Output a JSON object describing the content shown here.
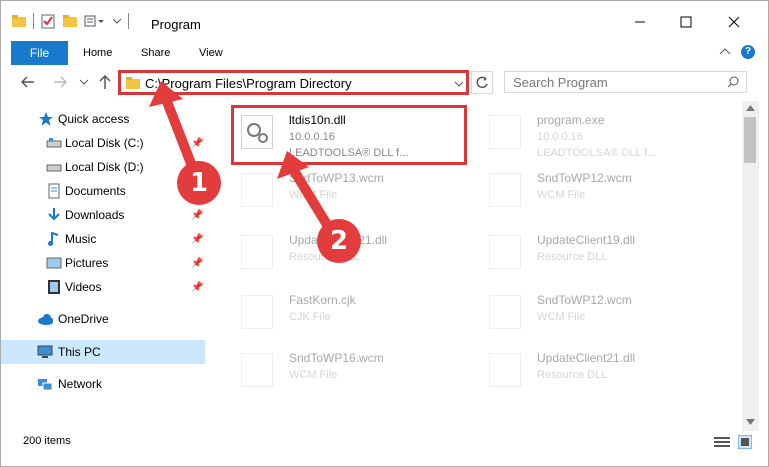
{
  "window": {
    "title": "Program"
  },
  "ribbon": {
    "tabs": [
      "File",
      "Home",
      "Share",
      "View"
    ],
    "help": "?"
  },
  "nav": {
    "address": "C:\\Program Files\\Program Directory",
    "search_placeholder": "Search Program"
  },
  "sidebar": {
    "items": [
      {
        "label": "Quick access",
        "pinned": false
      },
      {
        "label": "Local Disk (C:)",
        "pinned": true
      },
      {
        "label": "Local Disk (D:)",
        "pinned": true
      },
      {
        "label": "Documents",
        "pinned": true
      },
      {
        "label": "Downloads",
        "pinned": true
      },
      {
        "label": "Music",
        "pinned": true
      },
      {
        "label": "Pictures",
        "pinned": true
      },
      {
        "label": "Videos",
        "pinned": true
      },
      {
        "label": "OneDrive",
        "pinned": false
      },
      {
        "label": "This PC",
        "pinned": false
      },
      {
        "label": "Network",
        "pinned": false
      }
    ]
  },
  "files": [
    {
      "name": "ltdis10n.dll",
      "line2": "10.0.0.16",
      "line3": "LEADTOOLSA® DLL f..."
    },
    {
      "name": "program.exe",
      "line2": "10.0.0.16",
      "line3": "LEADTOOLSA® DLL f..."
    },
    {
      "name": "SndToWP13.wcm",
      "line2": "WCM File",
      "line3": ""
    },
    {
      "name": "SndToWP12.wcm",
      "line2": "WCM File",
      "line3": ""
    },
    {
      "name": "UpdateClient21.dll",
      "line2": "Resource DLL",
      "line3": ""
    },
    {
      "name": "UpdateClient19.dll",
      "line2": "Resource DLL",
      "line3": ""
    },
    {
      "name": "FastKorn.cjk",
      "line2": "CJK File",
      "line3": ""
    },
    {
      "name": "SndToWP12.wcm",
      "line2": "WCM File",
      "line3": ""
    },
    {
      "name": "SndToWP16.wcm",
      "line2": "WCM File",
      "line3": ""
    },
    {
      "name": "UpdateClient21.dll",
      "line2": "Resource DLL",
      "line3": ""
    }
  ],
  "status": {
    "count": "200 items"
  },
  "callouts": [
    "1",
    "2"
  ],
  "colors": {
    "accent": "#1979ca",
    "highlight": "#d7363a",
    "callout": "#e23c3c",
    "selected": "#cce8ff"
  }
}
